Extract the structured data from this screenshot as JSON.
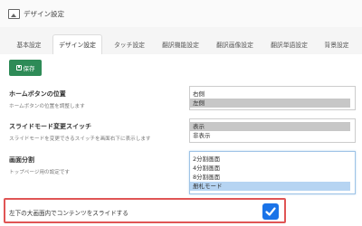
{
  "header": {
    "title": "デザイン設定",
    "icon": "image-icon"
  },
  "tabs": [
    {
      "label": "基本設定"
    },
    {
      "label": "デザイン設定",
      "active": true
    },
    {
      "label": "タッチ設定"
    },
    {
      "label": "翻訳機能設定"
    },
    {
      "label": "翻訳画像設定"
    },
    {
      "label": "翻訳単語設定"
    },
    {
      "label": "背景設定"
    }
  ],
  "toolbar": {
    "save_label": "保存",
    "save_icon": "floppy-disk-icon"
  },
  "settings": {
    "home_button": {
      "label": "ホームボタンの位置",
      "desc": "ホームボタンの位置を調整します",
      "options": [
        "右側",
        "左側"
      ],
      "selected": "左側"
    },
    "slide_mode": {
      "label": "スライドモード変更スイッチ",
      "desc": "スライドモードを変更できるスイッチを画面右下に表示します",
      "options": [
        "表示",
        "非表示"
      ],
      "selected": "表示"
    },
    "screen_split": {
      "label": "画面分割",
      "desc": "トップページ用の設定です",
      "options": [
        "2分割画面",
        "4分割画面",
        "8分割画面",
        "册札モード"
      ],
      "selected": "册札モード"
    },
    "slide_content": {
      "label": "左下の大画面内でコンテンツをスライドする",
      "checked": true
    }
  },
  "colors": {
    "save_button": "#2e8b57",
    "checkbox": "#1a73e8",
    "highlight_border": "#e05555",
    "selected_option": "#b6d4f2"
  }
}
